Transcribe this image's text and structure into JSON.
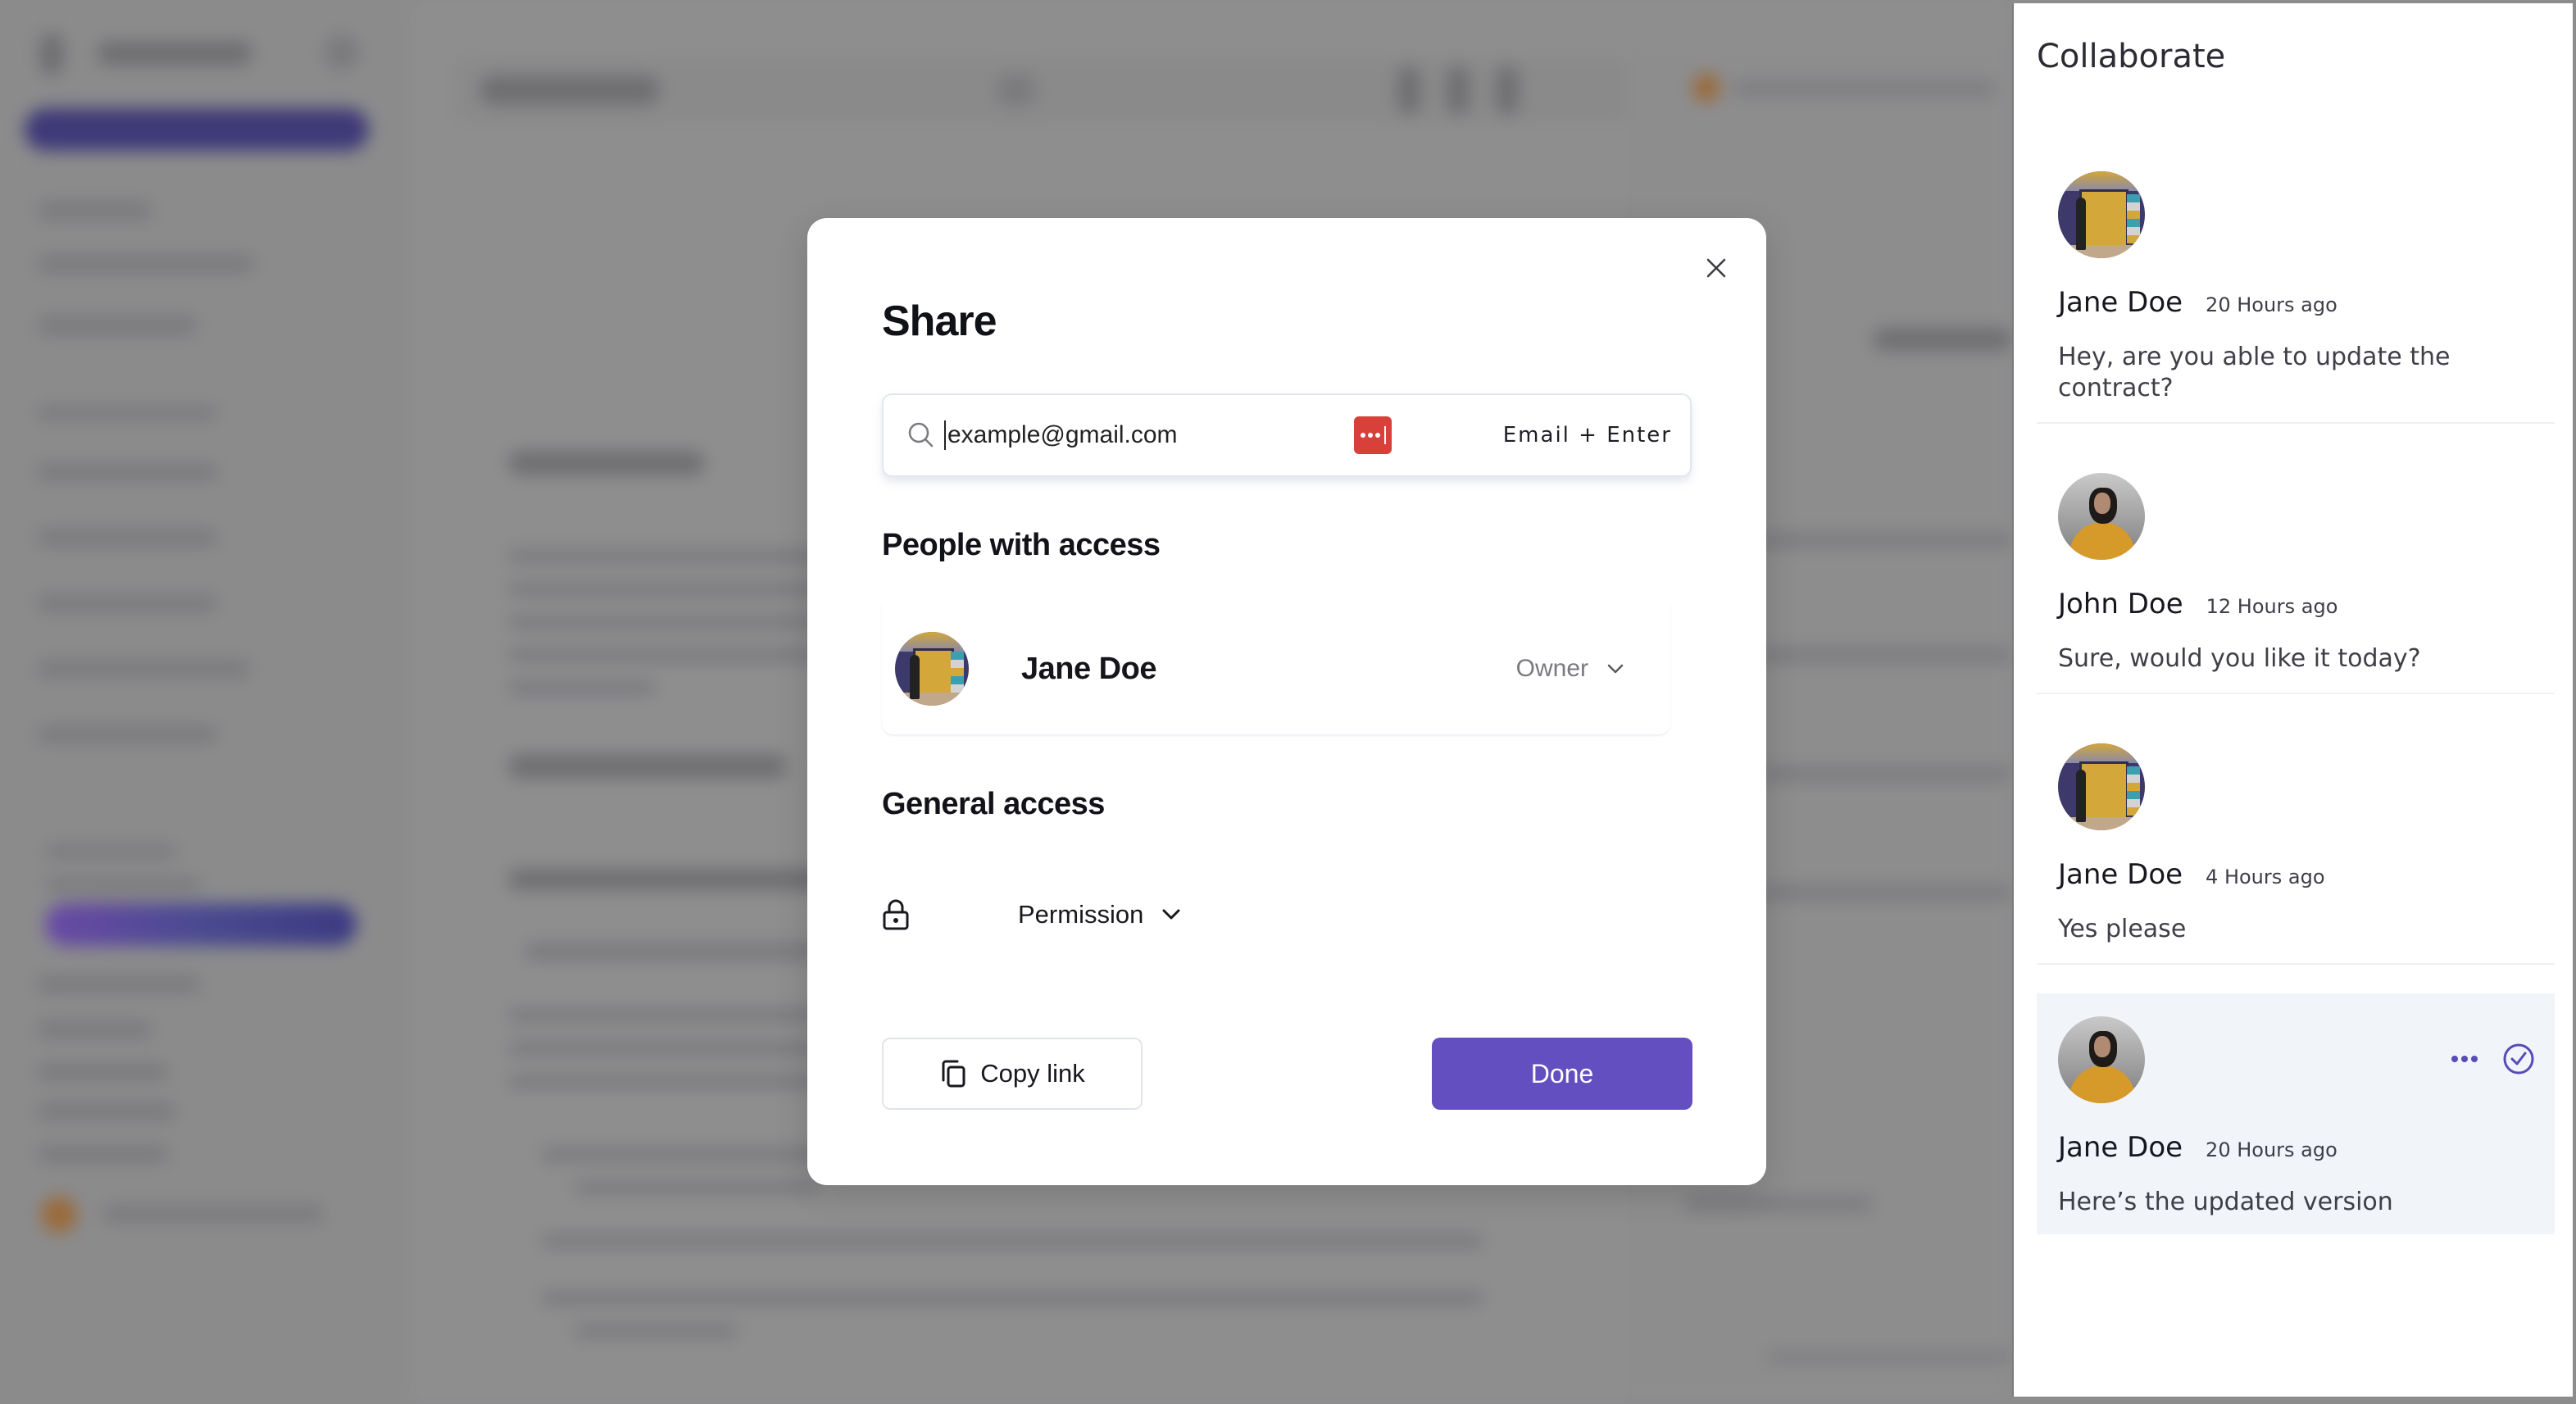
{
  "modal": {
    "title": "Share",
    "search": {
      "placeholder": "example@gmail.com",
      "value": "",
      "hint": "Email + Enter"
    },
    "people_section_title": "People with access",
    "people": [
      {
        "name": "Jane Doe",
        "role": "Owner",
        "avatar": "door-photo"
      }
    ],
    "general_access_title": "General access",
    "general_access": {
      "permission": "Permission"
    },
    "copy_link_label": "Copy link",
    "done_label": "Done",
    "accent_color": "#634fbf"
  },
  "collaborate": {
    "title": "Collaborate",
    "comments": [
      {
        "author": "Jane Doe",
        "time": "20 Hours ago",
        "text": "Hey, are you able to update the contract?",
        "avatar": "door-photo"
      },
      {
        "author": "John Doe",
        "time": "12 Hours ago",
        "text": "Sure, would you like it today?",
        "avatar": "man-photo"
      },
      {
        "author": "Jane Doe",
        "time": "4 Hours ago",
        "text": "Yes please",
        "avatar": "door-photo"
      },
      {
        "author": "Jane Doe",
        "time": "20 Hours ago",
        "text": "Here’s the updated version",
        "avatar": "man-photo",
        "active": true
      }
    ]
  },
  "icons": {
    "close": "close-icon",
    "search": "search-icon",
    "password_manager": "password-manager-icon",
    "chevron": "chevron-down-icon",
    "lock": "lock-icon",
    "copy": "copy-icon",
    "more": "more-horizontal-icon",
    "resolve": "check-circle-icon"
  }
}
